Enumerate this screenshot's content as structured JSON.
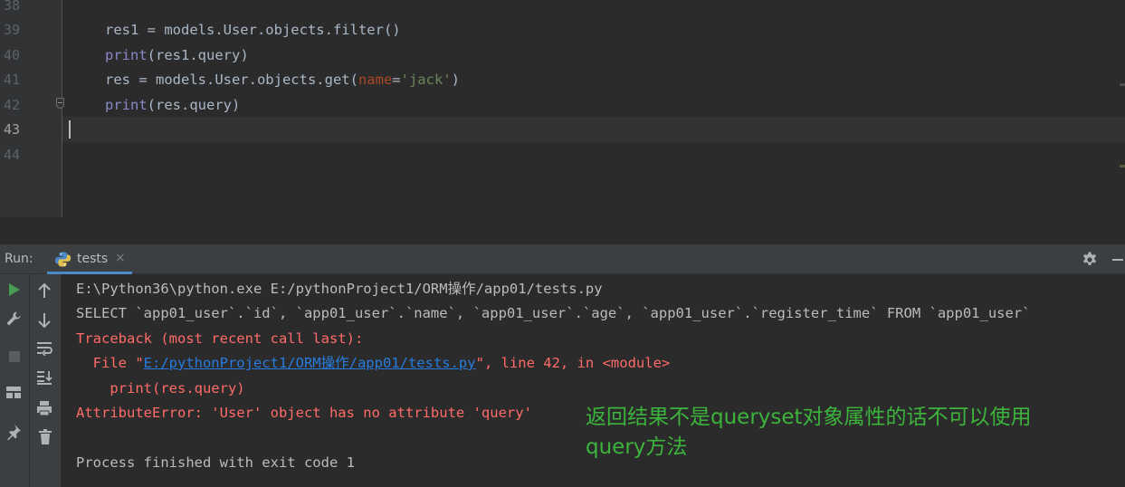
{
  "editor": {
    "line_numbers": [
      "38",
      "39",
      "40",
      "41",
      "42",
      "43",
      "44"
    ],
    "active_line": "43",
    "code": {
      "line39": "res1 = models.User.objects.filter()",
      "line40_print": "print",
      "line40_rest": "(res1.query)",
      "line41_a": "res = models.User.objects.get(",
      "line41_param": "name",
      "line41_eq": "=",
      "line41_str": "'jack'",
      "line41_close": ")",
      "line42_print": "print",
      "line42_rest": "(res.query)"
    }
  },
  "run_panel": {
    "label": "Run:",
    "tab_label": "tests",
    "tab_close": "×",
    "icons": {
      "run": "play-icon",
      "wrench": "wrench-icon",
      "stop": "stop-icon",
      "layout": "layout-icon",
      "pin": "pin-icon",
      "up": "arrow-up-icon",
      "down": "arrow-down-icon",
      "soft_wrap": "soft-wrap-icon",
      "scroll_end": "scroll-to-end-icon",
      "print": "print-icon",
      "trash": "trash-icon",
      "settings": "gear-icon",
      "minimize": "minimize-icon"
    }
  },
  "console": {
    "line1": "E:\\Python36\\python.exe E:/pythonProject1/ORM操作/app01/tests.py",
    "line2": "SELECT `app01_user`.`id`, `app01_user`.`name`, `app01_user`.`age`, `app01_user`.`register_time` FROM `app01_user`",
    "line3": "Traceback (most recent call last):",
    "line4_prefix": "  File \"",
    "line4_link": "E:/pythonProject1/ORM操作/app01/tests.py",
    "line4_suffix": "\", line 42, in <module>",
    "line5": "    print(res.query)",
    "line6": "AttributeError: 'User' object has no attribute 'query'",
    "line8": "Process finished with exit code 1"
  },
  "annotation": {
    "line1": "返回结果不是queryset对象属性的话不可以使用",
    "line2": "query方法"
  },
  "colors": {
    "background": "#2b2b2b",
    "gutter": "#313335",
    "panel": "#3c3f41",
    "error_text": "#ff6b68",
    "link": "#287bde",
    "annotation": "#3cb43c",
    "run_green": "#499c54",
    "tab_underline": "#4a88c7"
  }
}
